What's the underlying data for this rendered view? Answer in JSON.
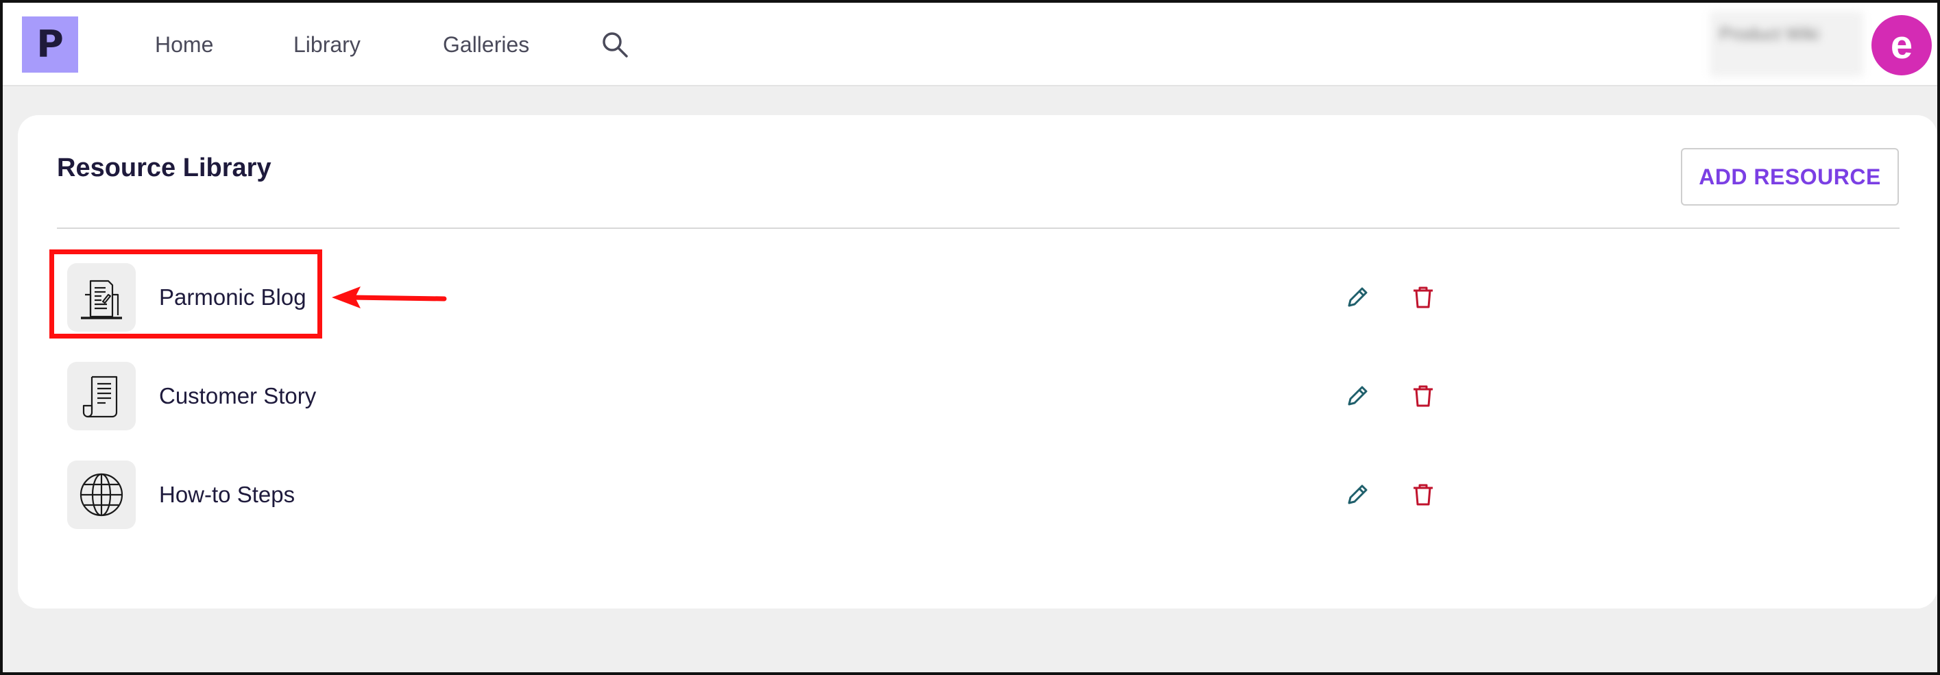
{
  "nav": {
    "logo_letter": "P",
    "items": [
      {
        "label": "Home"
      },
      {
        "label": "Library"
      },
      {
        "label": "Galleries"
      }
    ],
    "search_icon": "search-icon"
  },
  "user": {
    "name_blurred": "Product Wiki",
    "avatar_letter": "e",
    "avatar_color": "#d42bb4"
  },
  "page": {
    "title": "Resource Library",
    "add_button_label": "ADD RESOURCE"
  },
  "resources": [
    {
      "label": "Parmonic Blog",
      "icon": "newspaper-icon"
    },
    {
      "label": "Customer Story",
      "icon": "document-scroll-icon"
    },
    {
      "label": "How-to Steps",
      "icon": "globe-icon"
    }
  ],
  "colors": {
    "accent": "#7b3fe4",
    "logo_bg": "#a79bfb",
    "edit_icon": "#1f5f6b",
    "delete_icon": "#c0132d",
    "annotation": "#ff1010"
  }
}
